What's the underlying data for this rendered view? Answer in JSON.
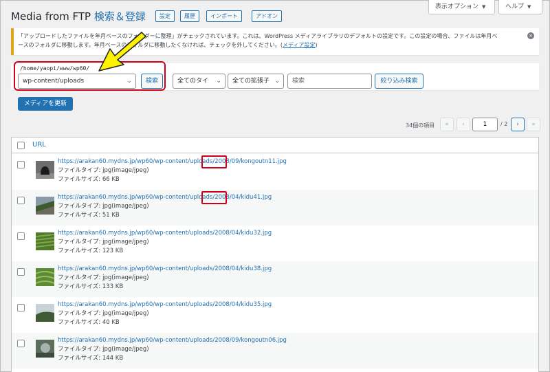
{
  "header": {
    "title": "Media from FTP",
    "subtitle": "検索＆登録",
    "buttons": [
      "設定",
      "履歴",
      "インポート",
      "アドオン"
    ],
    "screen_options": "表示オプション",
    "help": "ヘルプ"
  },
  "notice": {
    "text_a": "「アップロードしたファイルを年月ベースのフォルダーに整理」がチェックされています。これは、WordPress メディアライブラリのデフォルトの設定です。この設定の場合、ファイルは年月ベ",
    "text_b": "ースのフォルダに移動します。年月ベースのフォルダに移動したくなければ、チェックを外してください。(",
    "link": "メディア設定",
    "text_c": ")",
    "dismiss": "×"
  },
  "filters": {
    "path_label": "/home/yaopi/www/wp60/",
    "directory_value": "wp-content/uploads",
    "search_button": "検索",
    "type_select": "全てのタイ",
    "ext_select": "全ての拡張子",
    "search_placeholder": "検索",
    "filter_button": "絞り込み検索"
  },
  "update_button": "メディアを更新",
  "pagination": {
    "count": "34個の項目",
    "first": "«",
    "prev": "‹",
    "current": "1",
    "total": "/ 2",
    "next": "›",
    "last": "»"
  },
  "table": {
    "column": "URL",
    "type_label": "ファイルタイプ:",
    "size_label": "ファイルサイズ:",
    "rows": [
      {
        "url": "https://arakan60.mydns.jp/wp60/wp-content/uploads/2008/09/kongoutn11.jpg",
        "type": "jpg(image/jpeg)",
        "size": "66 KB"
      },
      {
        "url": "https://arakan60.mydns.jp/wp60/wp-content/uploads/2008/04/kidu41.jpg",
        "type": "jpg(image/jpeg)",
        "size": "51 KB"
      },
      {
        "url": "https://arakan60.mydns.jp/wp60/wp-content/uploads/2008/04/kidu32.jpg",
        "type": "jpg(image/jpeg)",
        "size": "123 KB"
      },
      {
        "url": "https://arakan60.mydns.jp/wp60/wp-content/uploads/2008/04/kidu38.jpg",
        "type": "jpg(image/jpeg)",
        "size": "133 KB"
      },
      {
        "url": "https://arakan60.mydns.jp/wp60/wp-content/uploads/2008/04/kidu35.jpg",
        "type": "jpg(image/jpeg)",
        "size": "40 KB"
      },
      {
        "url": "https://arakan60.mydns.jp/wp60/wp-content/uploads/2008/09/kongoutn06.jpg",
        "type": "jpg(image/jpeg)",
        "size": "144 KB"
      }
    ]
  },
  "colors": {
    "accent": "#2271b1",
    "notice_border": "#dba617",
    "highlight_red": "#d0021b",
    "arrow_yellow": "#fff200"
  },
  "icons": {
    "arrow": "yellow-arrow-icon",
    "dismiss": "dismiss-icon",
    "chevron": "chevron-down-icon"
  }
}
